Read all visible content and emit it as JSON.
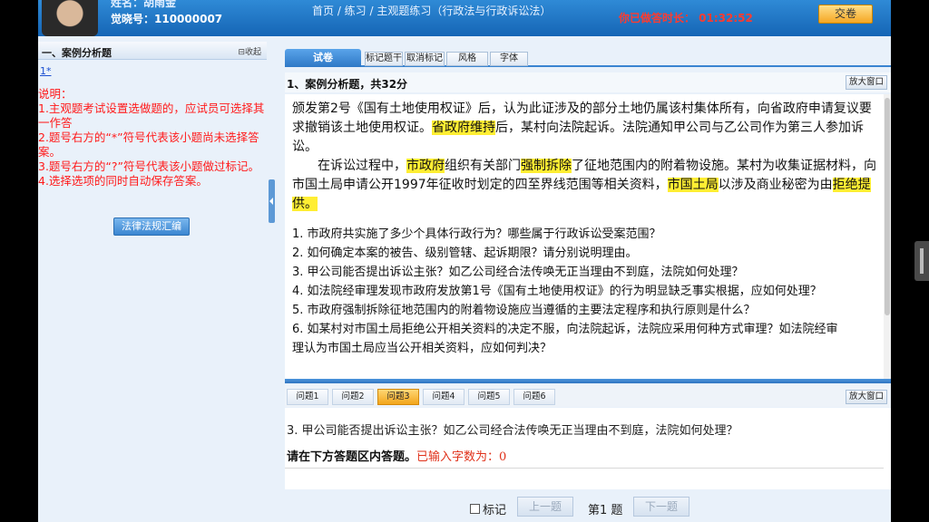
{
  "header": {
    "user_name": "姓名：胡雨金",
    "exam_id": "觉晓号：110000007",
    "breadcrumb": "首页 / 练习 / 主观题练习（行政法与行政诉讼法）",
    "timer_label_top": "",
    "timer": "你已做答时长：  01:32:52",
    "submit_label": "交卷"
  },
  "left": {
    "title": "一、案例分析题",
    "collapse_label": "⊟收起",
    "question_link": "1*",
    "notes": [
      "说明：",
      "1.主观题考试设置选做题的，应试员可选择其一作答",
      "2.题号右方的“*”符号代表该小题尚未选择答案。",
      "3.题号右方的“?”符号代表该小题做过标记。",
      "4.选择选项的同时自动保存答案。"
    ],
    "laws_button": "法律法规汇编"
  },
  "main": {
    "tab_label": "试卷",
    "tools": [
      "标记题干",
      "取消标记",
      "风格",
      "字体"
    ],
    "section_title": "1、案例分析题，共32分",
    "enlarge_label": "放大窗口",
    "case": {
      "p1_a": "颁发第2号《国有土地使用权证》后，认为此证涉及的部分土地仍属该村集体所有，向省政府申请复议要求撤销该土地使用权证。",
      "p1_hl": "省政府维持",
      "p1_b": "后，某村向法院起诉。法院通知甲公司与乙公司作为第三人参加诉讼。",
      "p2_a": "在诉讼过程中，",
      "p2_hl1": "市政府",
      "p2_b": "组织有关部门",
      "p2_hl2": "强制拆除",
      "p2_c": "了征地范围内的附着物设施。某村为收集证据材料，向市国土局申请公开1997年征收时划定的四至界线范围等相关资料，",
      "p2_hl3": "市国土局",
      "p2_d": "以涉及商业秘密为由",
      "p2_hl4": "拒绝提供。"
    },
    "questions": [
      "1. 市政府共实施了多少个具体行政行为？哪些属于行政诉讼受案范围？",
      "2. 如何确定本案的被告、级别管辖、起诉期限？请分别说明理由。",
      "3. 甲公司能否提出诉讼主张？如乙公司经合法传唤无正当理由不到庭，法院如何处理？",
      "4. 如法院经审理发现市政府发放第1号《国有土地使用权证》的行为明显缺乏事实根据，应如何处理？",
      "5. 市政府强制拆除征地范围内的附着物设施应当遵循的主要法定程序和执行原则是什么？",
      "6. 如某村对市国土局拒绝公开相关资料的决定不服，向法院起诉，法院应采用何种方式审理？如法院经审",
      "理认为市国土局应当公开相关资料，应如何判决？"
    ],
    "qtabs": [
      "问题1",
      "问题2",
      "问题3",
      "问题4",
      "问题5",
      "问题6"
    ],
    "active_qtab": 2,
    "enlarge_label2": "放大窗口",
    "current_question": "3. 甲公司能否提出诉讼主张？如乙公司经合法传唤无正当理由不到庭，法院如何处理？",
    "answer_prompt": "请在下方答题区内答题。",
    "answer_count": "已输入字数为：0"
  },
  "bottom": {
    "mark_label": "标记",
    "prev_label": "上一题",
    "page_label": "第1 题",
    "next_label": "下一题"
  }
}
